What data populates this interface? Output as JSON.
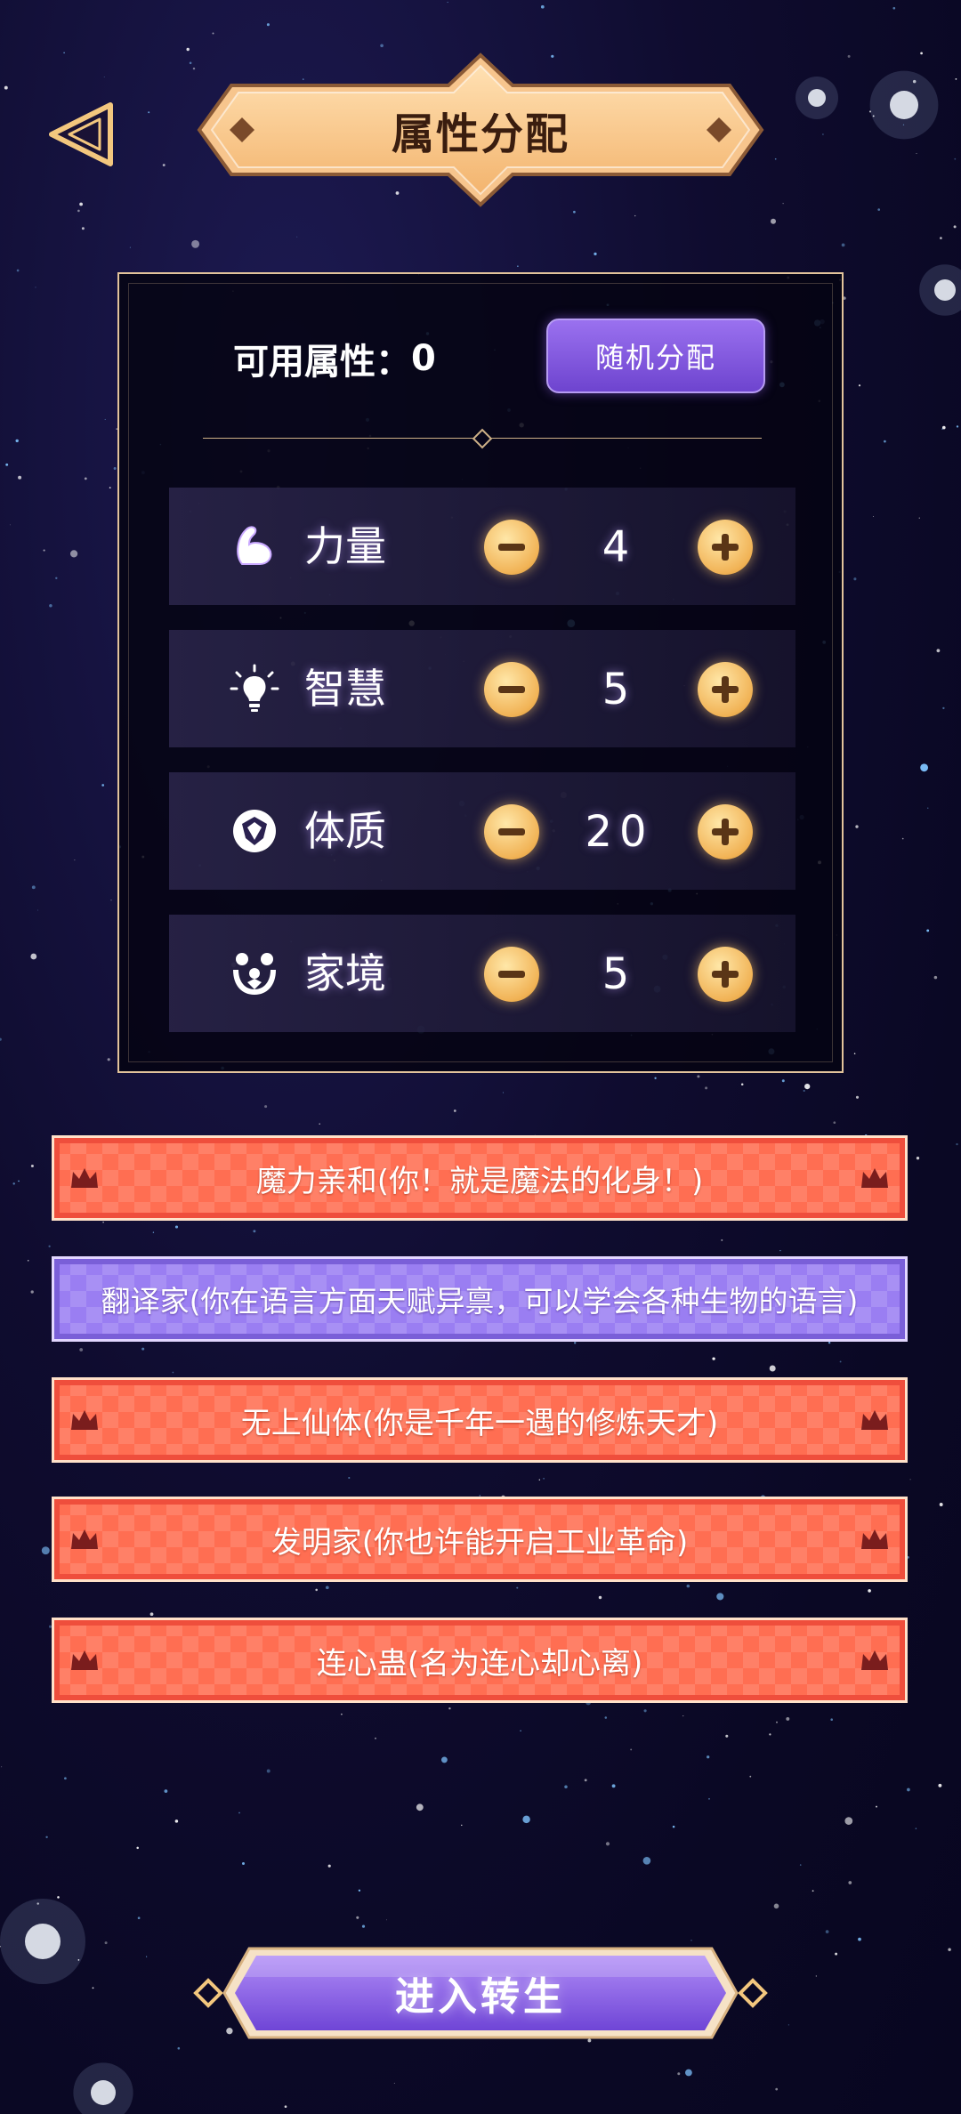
{
  "header": {
    "title": "属性分配"
  },
  "attributes": {
    "available_label": "可用属性：",
    "available_value": "0",
    "random_button": "随机分配",
    "items": [
      {
        "label": "力量",
        "value": "4",
        "icon": "flexed-arm-icon"
      },
      {
        "label": "智慧",
        "value": "5",
        "icon": "lightbulb-icon"
      },
      {
        "label": "体质",
        "value": "20",
        "icon": "shield-circle-icon"
      },
      {
        "label": "家境",
        "value": "5",
        "icon": "family-icon"
      }
    ]
  },
  "talents": [
    {
      "text": "魔力亲和(你！就是魔法的化身！)",
      "style": "orange"
    },
    {
      "text": "翻译家(你在语言方面天赋异禀，可以学会各种生物的语言)",
      "style": "purple"
    },
    {
      "text": "无上仙体(你是千年一遇的修炼天才)",
      "style": "orange"
    },
    {
      "text": "发明家(你也许能开启工业革命)",
      "style": "orange"
    },
    {
      "text": "连心蛊(名为连心却心离)",
      "style": "orange"
    }
  ],
  "footer": {
    "enter_button": "进入转生"
  },
  "colors": {
    "accent_gold": "#f1b356",
    "accent_purple": "#8b60e6",
    "talent_orange": "#ff6e52",
    "talent_purple": "#9a7ef2"
  }
}
